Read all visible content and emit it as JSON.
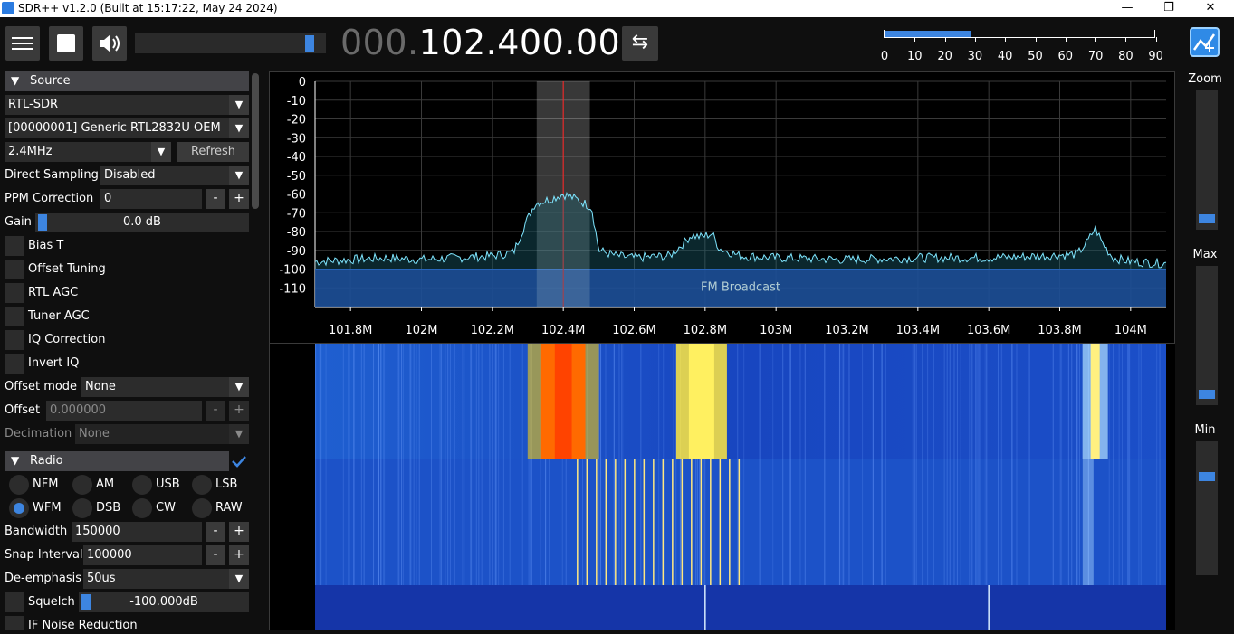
{
  "window": {
    "title": "SDR++ v1.2.0 (Built at 15:17:22, May 24 2024)",
    "minimize": "—",
    "maximize": "❐",
    "close": "✕"
  },
  "toolbar": {
    "volume_level": 0.95,
    "freq_dim": "000.",
    "freq_lit": "102.400.000",
    "swap_icon": "⇆",
    "snr_level": 32,
    "snr_ticks": [
      "0",
      "10",
      "20",
      "30",
      "40",
      "50",
      "60",
      "70",
      "80",
      "90"
    ]
  },
  "source": {
    "header": "Source",
    "device_type": "RTL-SDR",
    "device": "[00000001] Generic RTL2832U OEM",
    "sample_rate": "2.4MHz",
    "refresh": "Refresh",
    "direct_sampling_label": "Direct Sampling",
    "direct_sampling": "Disabled",
    "ppm_label": "PPM Correction",
    "ppm": "0",
    "gain_label": "Gain",
    "gain": "0.0 dB",
    "bias_t": "Bias T",
    "offset_tuning": "Offset Tuning",
    "rtl_agc": "RTL AGC",
    "tuner_agc": "Tuner AGC",
    "iq_correction": "IQ Correction",
    "invert_iq": "Invert IQ",
    "offset_mode_label": "Offset mode",
    "offset_mode": "None",
    "offset_label": "Offset",
    "offset": "0.000000",
    "decimation_label": "Decimation",
    "decimation": "None"
  },
  "radio": {
    "header": "Radio",
    "modes": [
      "NFM",
      "AM",
      "USB",
      "LSB",
      "WFM",
      "DSB",
      "CW",
      "RAW"
    ],
    "selected_mode": "WFM",
    "bandwidth_label": "Bandwidth",
    "bandwidth": "150000",
    "snap_label": "Snap Interval",
    "snap": "100000",
    "deemph_label": "De-emphasis",
    "deemph": "50us",
    "squelch_label": "Squelch",
    "squelch": "-100.000dB",
    "if_nr_label": "IF Noise Reduction",
    "minus": "-",
    "plus": "+"
  },
  "right_panel": {
    "zoom": "Zoom",
    "max": "Max",
    "min": "Min"
  },
  "chart_data": {
    "type": "line",
    "ylabel_ticks": [
      "0",
      "-10",
      "-20",
      "-30",
      "-40",
      "-50",
      "-60",
      "-70",
      "-80",
      "-90",
      "-100",
      "-110"
    ],
    "ylim": [
      -120,
      0
    ],
    "xlim": [
      101.7,
      104.1
    ],
    "x_ticks": [
      {
        "v": 101.8,
        "label": "101.8M"
      },
      {
        "v": 102.0,
        "label": "102M"
      },
      {
        "v": 102.2,
        "label": "102.2M"
      },
      {
        "v": 102.4,
        "label": "102.4M"
      },
      {
        "v": 102.6,
        "label": "102.6M"
      },
      {
        "v": 102.8,
        "label": "102.8M"
      },
      {
        "v": 103.0,
        "label": "103M"
      },
      {
        "v": 103.2,
        "label": "103.2M"
      },
      {
        "v": 103.4,
        "label": "103.4M"
      },
      {
        "v": 103.6,
        "label": "103.6M"
      },
      {
        "v": 103.8,
        "label": "103.8M"
      },
      {
        "v": 104.0,
        "label": "104M"
      }
    ],
    "vfo": {
      "center": 102.4,
      "low": 102.325,
      "high": 102.475
    },
    "band": {
      "label": "FM Broadcast",
      "top_db": -100
    },
    "series": [
      {
        "x": [
          101.7,
          101.8,
          101.9,
          102.0,
          102.1,
          102.2,
          102.26,
          102.29,
          102.32,
          102.36,
          102.4,
          102.44,
          102.48,
          102.5,
          102.55,
          102.6,
          102.7,
          102.74,
          102.76,
          102.79,
          102.82,
          102.84,
          102.9,
          103.0,
          103.2,
          103.4,
          103.6,
          103.75,
          103.85,
          103.88,
          103.9,
          103.92,
          103.95,
          104.0,
          104.1
        ],
        "y": [
          -96,
          -95,
          -94,
          -95,
          -94,
          -93,
          -91,
          -77,
          -65,
          -63,
          -60,
          -63,
          -67,
          -90,
          -93,
          -94,
          -93,
          -86,
          -82,
          -83,
          -81,
          -89,
          -93,
          -94,
          -95,
          -94,
          -94,
          -93,
          -92,
          -85,
          -78,
          -86,
          -94,
          -96,
          -97
        ]
      }
    ]
  }
}
